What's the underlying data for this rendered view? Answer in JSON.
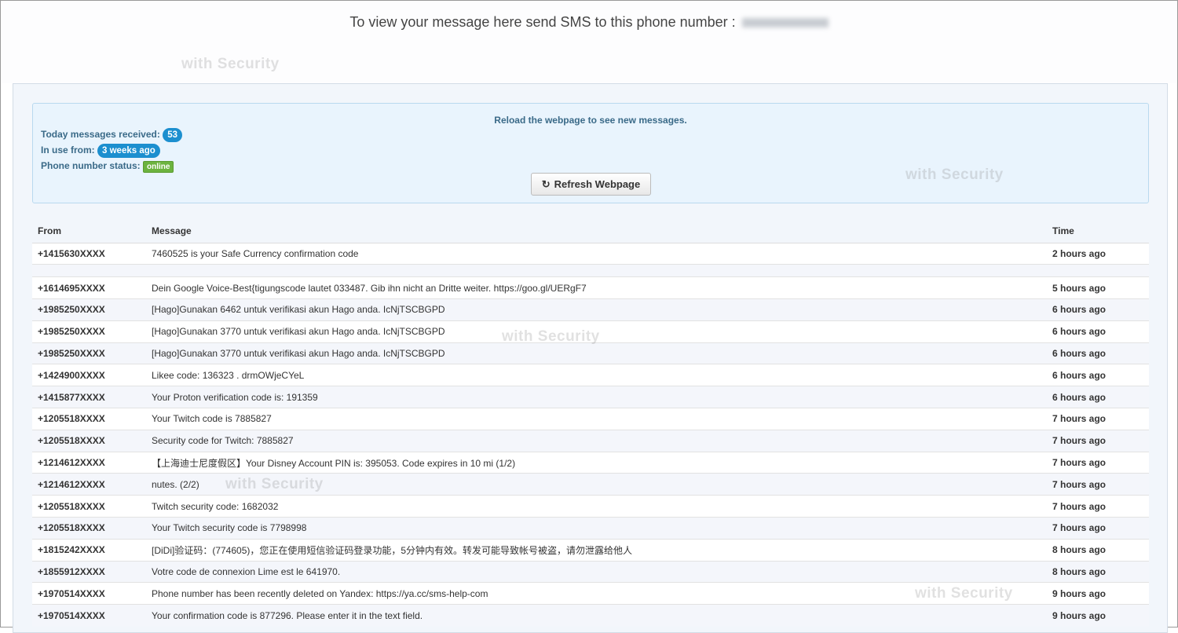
{
  "header": {
    "title": "To view your message here send SMS to this phone number :"
  },
  "watermark": "withSecurity",
  "info": {
    "reload_text": "Reload the webpage to see new messages.",
    "today_label": "Today messages received:",
    "today_count": "53",
    "in_use_label": "In use from:",
    "in_use_value": "3 weeks ago",
    "status_label": "Phone number status:",
    "status_value": "online",
    "refresh_button": "Refresh Webpage"
  },
  "table": {
    "headers": {
      "from": "From",
      "message": "Message",
      "time": "Time"
    },
    "rows": [
      {
        "from": "+1415630XXXX",
        "message": "7460525 is your Safe Currency confirmation code",
        "time": "2 hours ago"
      },
      {
        "from": "",
        "message": "",
        "time": ""
      },
      {
        "from": "+1614695XXXX",
        "message": "Dein Google Voice-Best{tigungscode lautet 033487. Gib ihn nicht an Dritte weiter. https://goo.gl/UERgF7",
        "time": "5 hours ago"
      },
      {
        "from": "+1985250XXXX",
        "message": "[Hago]Gunakan 6462 untuk verifikasi akun Hago anda. IcNjTSCBGPD",
        "time": "6 hours ago"
      },
      {
        "from": "+1985250XXXX",
        "message": "[Hago]Gunakan 3770 untuk verifikasi akun Hago anda. IcNjTSCBGPD",
        "time": "6 hours ago"
      },
      {
        "from": "+1985250XXXX",
        "message": "[Hago]Gunakan 3770 untuk verifikasi akun Hago anda. IcNjTSCBGPD",
        "time": "6 hours ago"
      },
      {
        "from": "+1424900XXXX",
        "message": "Likee code: 136323 . drmOWjeCYeL",
        "time": "6 hours ago"
      },
      {
        "from": "+1415877XXXX",
        "message": "Your Proton verification code is: 191359",
        "time": "6 hours ago"
      },
      {
        "from": "+1205518XXXX",
        "message": "Your Twitch code is 7885827",
        "time": "7 hours ago"
      },
      {
        "from": "+1205518XXXX",
        "message": "Security code for Twitch: 7885827",
        "time": "7 hours ago"
      },
      {
        "from": "+1214612XXXX",
        "message": "【上海迪士尼度假区】Your Disney Account PIN is: 395053. Code expires in 10 mi (1/2)",
        "time": "7 hours ago"
      },
      {
        "from": "+1214612XXXX",
        "message": "nutes. (2/2)",
        "time": "7 hours ago"
      },
      {
        "from": "+1205518XXXX",
        "message": "Twitch security code: 1682032",
        "time": "7 hours ago"
      },
      {
        "from": "+1205518XXXX",
        "message": "Your Twitch security code is 7798998",
        "time": "7 hours ago"
      },
      {
        "from": "+1815242XXXX",
        "message": "[DiDi]验证码：(774605)，您正在使用短信验证码登录功能，5分钟内有效。转发可能导致帐号被盗，请勿泄露给他人",
        "time": "8 hours ago"
      },
      {
        "from": "+1855912XXXX",
        "message": "Votre code de connexion Lime est le 641970.",
        "time": "8 hours ago"
      },
      {
        "from": "+1970514XXXX",
        "message": "Phone number has been recently deleted on Yandex: https://ya.cc/sms-help-com",
        "time": "9 hours ago"
      },
      {
        "from": "+1970514XXXX",
        "message": "Your confirmation code is 877296. Please enter it in the text field.",
        "time": "9 hours ago"
      }
    ]
  }
}
